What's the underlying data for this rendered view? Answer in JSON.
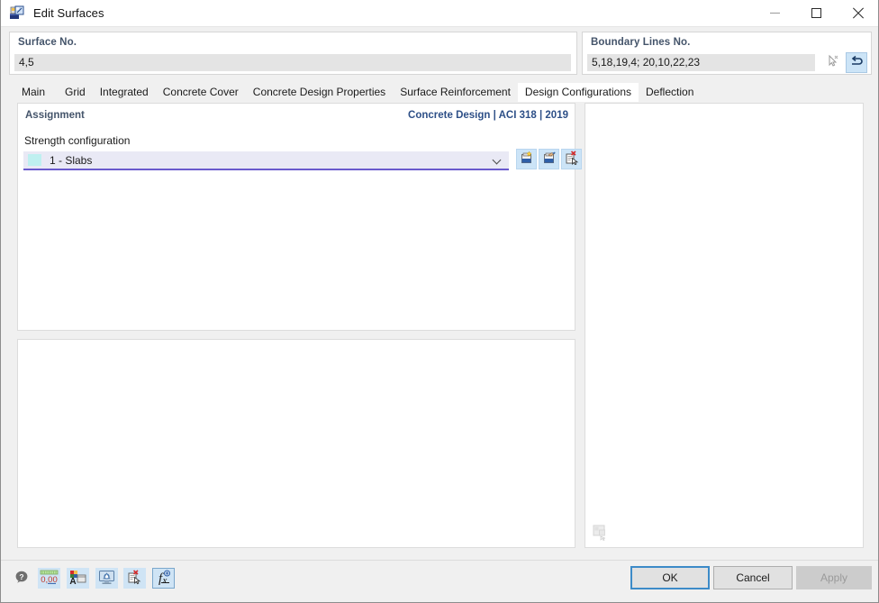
{
  "window": {
    "title": "Edit Surfaces",
    "icon": "edit-surfaces-icon",
    "minimize_label": "Minimize",
    "maximize_label": "Maximize",
    "close_label": "Close"
  },
  "header": {
    "surface": {
      "label": "Surface No.",
      "value": "4,5",
      "placeholder": ""
    },
    "boundary": {
      "label": "Boundary Lines No.",
      "value": "5,18,19,4; 20,10,22,23",
      "placeholder": "",
      "pick_icon": "select-cursor-icon",
      "reverse_icon": "reverse-orientation-icon"
    }
  },
  "tabs": [
    {
      "label": "Main",
      "active": false
    },
    {
      "label": "Grid",
      "active": false
    },
    {
      "label": "Integrated",
      "active": false
    },
    {
      "label": "Concrete Cover",
      "active": false
    },
    {
      "label": "Concrete Design Properties",
      "active": false
    },
    {
      "label": "Surface Reinforcement",
      "active": false
    },
    {
      "label": "Design Configurations",
      "active": true
    },
    {
      "label": "Deflection",
      "active": false
    }
  ],
  "assignment": {
    "title": "Assignment",
    "design_code": "Concrete Design | ACI 318 | 2019",
    "strength_label": "Strength configuration",
    "combo": {
      "value": "1 - Slabs",
      "swatch_color": "#bff0f0",
      "chevron_icon": "chevron-down-icon"
    },
    "buttons": [
      {
        "name": "new-configuration-button",
        "icon": "new-item-icon"
      },
      {
        "name": "edit-configuration-button",
        "icon": "edit-item-icon"
      },
      {
        "name": "delete-configuration-button",
        "icon": "delete-item-icon"
      }
    ]
  },
  "right_panel": {
    "icon": "preview-image-icon"
  },
  "toolbar": [
    {
      "name": "help-button",
      "icon": "help-bubble-icon"
    },
    {
      "name": "decimal-places-button",
      "icon": "decimal-places-icon"
    },
    {
      "name": "display-properties-button",
      "icon": "display-properties-icon"
    },
    {
      "name": "view-settings-button",
      "icon": "view-settings-icon"
    },
    {
      "name": "clear-selection-button",
      "icon": "clear-selection-icon"
    },
    {
      "name": "formula-button",
      "icon": "formula-icon"
    }
  ],
  "footer": {
    "ok_label": "OK",
    "cancel_label": "Cancel",
    "apply_label": "Apply",
    "apply_enabled": false
  },
  "colors": {
    "accent_blue": "#44546a",
    "code_blue": "#2d4f87",
    "combo_underline": "#6a5acd",
    "icon_button_bg": "#cce4f7",
    "focus_border": "#3d8bc8"
  }
}
